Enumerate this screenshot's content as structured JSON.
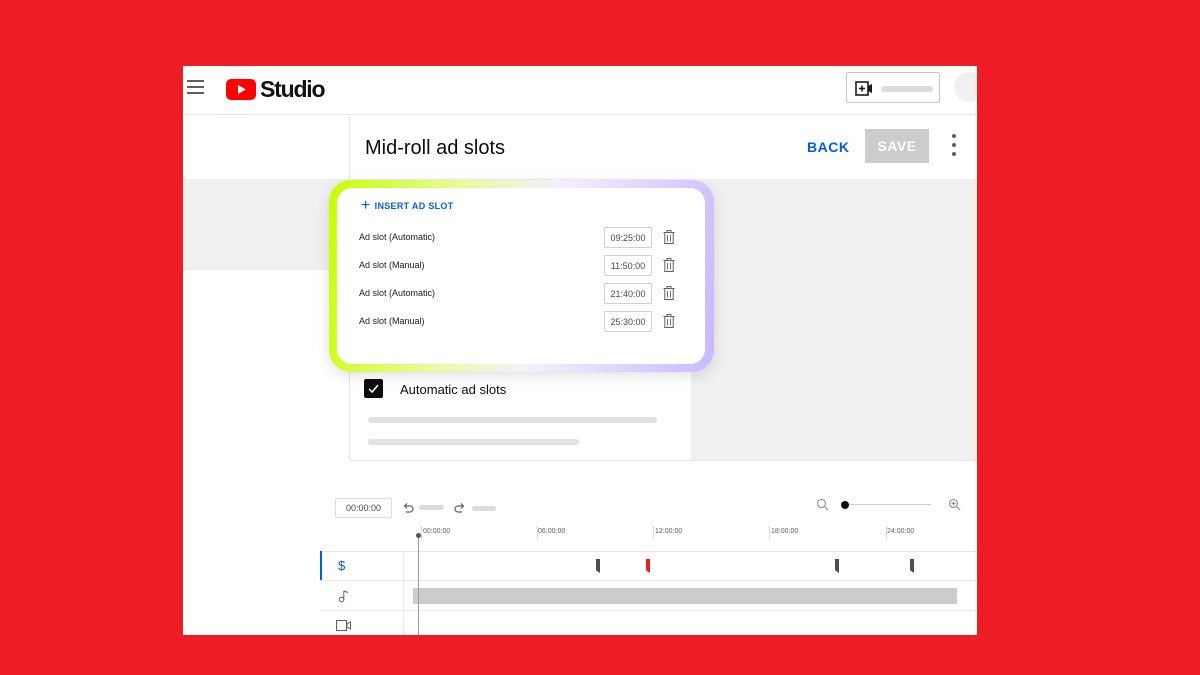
{
  "app": {
    "logo_text": "Studio"
  },
  "header": {
    "title": "Mid-roll ad slots",
    "back_label": "BACK",
    "save_label": "SAVE"
  },
  "ad_slots": {
    "insert_label": "INSERT AD SLOT",
    "items": [
      {
        "label": "Ad slot (Automatic)",
        "time": "09:25:00"
      },
      {
        "label": "Ad slot (Manual)",
        "time": "11:50:00"
      },
      {
        "label": "Ad slot (Automatic)",
        "time": "21:40:00"
      },
      {
        "label": "Ad slot (Manual)",
        "time": "25:30:00"
      }
    ]
  },
  "automatic": {
    "label": "Automatic ad slots",
    "checked": true
  },
  "timeline": {
    "current_time": "00:00:00",
    "ruler": [
      "00:00:00",
      "06:00:00",
      "12:00:00",
      "18:00:00",
      "24:00:00"
    ],
    "tracks": [
      {
        "icon": "dollar-icon",
        "active": true
      },
      {
        "icon": "music-note-icon",
        "active": false
      },
      {
        "icon": "video-camera-icon",
        "active": false
      }
    ]
  },
  "colors": {
    "background": "#ee1c25",
    "accent_blue": "#065fd4",
    "marker_red": "#ee1c25",
    "youtube_red": "#ff0000"
  }
}
